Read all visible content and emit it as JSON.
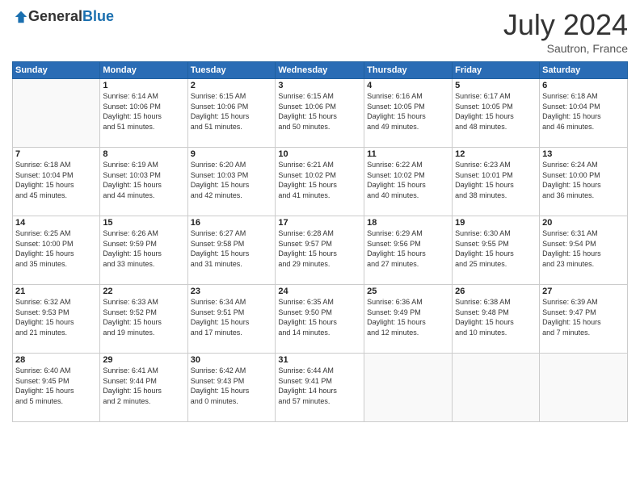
{
  "header": {
    "logo": {
      "general": "General",
      "blue": "Blue"
    },
    "title": "July 2024",
    "location": "Sautron, France"
  },
  "calendar": {
    "columns": [
      "Sunday",
      "Monday",
      "Tuesday",
      "Wednesday",
      "Thursday",
      "Friday",
      "Saturday"
    ],
    "rows": [
      [
        {
          "day": "",
          "info": ""
        },
        {
          "day": "1",
          "info": "Sunrise: 6:14 AM\nSunset: 10:06 PM\nDaylight: 15 hours\nand 51 minutes."
        },
        {
          "day": "2",
          "info": "Sunrise: 6:15 AM\nSunset: 10:06 PM\nDaylight: 15 hours\nand 51 minutes."
        },
        {
          "day": "3",
          "info": "Sunrise: 6:15 AM\nSunset: 10:06 PM\nDaylight: 15 hours\nand 50 minutes."
        },
        {
          "day": "4",
          "info": "Sunrise: 6:16 AM\nSunset: 10:05 PM\nDaylight: 15 hours\nand 49 minutes."
        },
        {
          "day": "5",
          "info": "Sunrise: 6:17 AM\nSunset: 10:05 PM\nDaylight: 15 hours\nand 48 minutes."
        },
        {
          "day": "6",
          "info": "Sunrise: 6:18 AM\nSunset: 10:04 PM\nDaylight: 15 hours\nand 46 minutes."
        }
      ],
      [
        {
          "day": "7",
          "info": "Sunrise: 6:18 AM\nSunset: 10:04 PM\nDaylight: 15 hours\nand 45 minutes."
        },
        {
          "day": "8",
          "info": "Sunrise: 6:19 AM\nSunset: 10:03 PM\nDaylight: 15 hours\nand 44 minutes."
        },
        {
          "day": "9",
          "info": "Sunrise: 6:20 AM\nSunset: 10:03 PM\nDaylight: 15 hours\nand 42 minutes."
        },
        {
          "day": "10",
          "info": "Sunrise: 6:21 AM\nSunset: 10:02 PM\nDaylight: 15 hours\nand 41 minutes."
        },
        {
          "day": "11",
          "info": "Sunrise: 6:22 AM\nSunset: 10:02 PM\nDaylight: 15 hours\nand 40 minutes."
        },
        {
          "day": "12",
          "info": "Sunrise: 6:23 AM\nSunset: 10:01 PM\nDaylight: 15 hours\nand 38 minutes."
        },
        {
          "day": "13",
          "info": "Sunrise: 6:24 AM\nSunset: 10:00 PM\nDaylight: 15 hours\nand 36 minutes."
        }
      ],
      [
        {
          "day": "14",
          "info": "Sunrise: 6:25 AM\nSunset: 10:00 PM\nDaylight: 15 hours\nand 35 minutes."
        },
        {
          "day": "15",
          "info": "Sunrise: 6:26 AM\nSunset: 9:59 PM\nDaylight: 15 hours\nand 33 minutes."
        },
        {
          "day": "16",
          "info": "Sunrise: 6:27 AM\nSunset: 9:58 PM\nDaylight: 15 hours\nand 31 minutes."
        },
        {
          "day": "17",
          "info": "Sunrise: 6:28 AM\nSunset: 9:57 PM\nDaylight: 15 hours\nand 29 minutes."
        },
        {
          "day": "18",
          "info": "Sunrise: 6:29 AM\nSunset: 9:56 PM\nDaylight: 15 hours\nand 27 minutes."
        },
        {
          "day": "19",
          "info": "Sunrise: 6:30 AM\nSunset: 9:55 PM\nDaylight: 15 hours\nand 25 minutes."
        },
        {
          "day": "20",
          "info": "Sunrise: 6:31 AM\nSunset: 9:54 PM\nDaylight: 15 hours\nand 23 minutes."
        }
      ],
      [
        {
          "day": "21",
          "info": "Sunrise: 6:32 AM\nSunset: 9:53 PM\nDaylight: 15 hours\nand 21 minutes."
        },
        {
          "day": "22",
          "info": "Sunrise: 6:33 AM\nSunset: 9:52 PM\nDaylight: 15 hours\nand 19 minutes."
        },
        {
          "day": "23",
          "info": "Sunrise: 6:34 AM\nSunset: 9:51 PM\nDaylight: 15 hours\nand 17 minutes."
        },
        {
          "day": "24",
          "info": "Sunrise: 6:35 AM\nSunset: 9:50 PM\nDaylight: 15 hours\nand 14 minutes."
        },
        {
          "day": "25",
          "info": "Sunrise: 6:36 AM\nSunset: 9:49 PM\nDaylight: 15 hours\nand 12 minutes."
        },
        {
          "day": "26",
          "info": "Sunrise: 6:38 AM\nSunset: 9:48 PM\nDaylight: 15 hours\nand 10 minutes."
        },
        {
          "day": "27",
          "info": "Sunrise: 6:39 AM\nSunset: 9:47 PM\nDaylight: 15 hours\nand 7 minutes."
        }
      ],
      [
        {
          "day": "28",
          "info": "Sunrise: 6:40 AM\nSunset: 9:45 PM\nDaylight: 15 hours\nand 5 minutes."
        },
        {
          "day": "29",
          "info": "Sunrise: 6:41 AM\nSunset: 9:44 PM\nDaylight: 15 hours\nand 2 minutes."
        },
        {
          "day": "30",
          "info": "Sunrise: 6:42 AM\nSunset: 9:43 PM\nDaylight: 15 hours\nand 0 minutes."
        },
        {
          "day": "31",
          "info": "Sunrise: 6:44 AM\nSunset: 9:41 PM\nDaylight: 14 hours\nand 57 minutes."
        },
        {
          "day": "",
          "info": ""
        },
        {
          "day": "",
          "info": ""
        },
        {
          "day": "",
          "info": ""
        }
      ]
    ]
  }
}
